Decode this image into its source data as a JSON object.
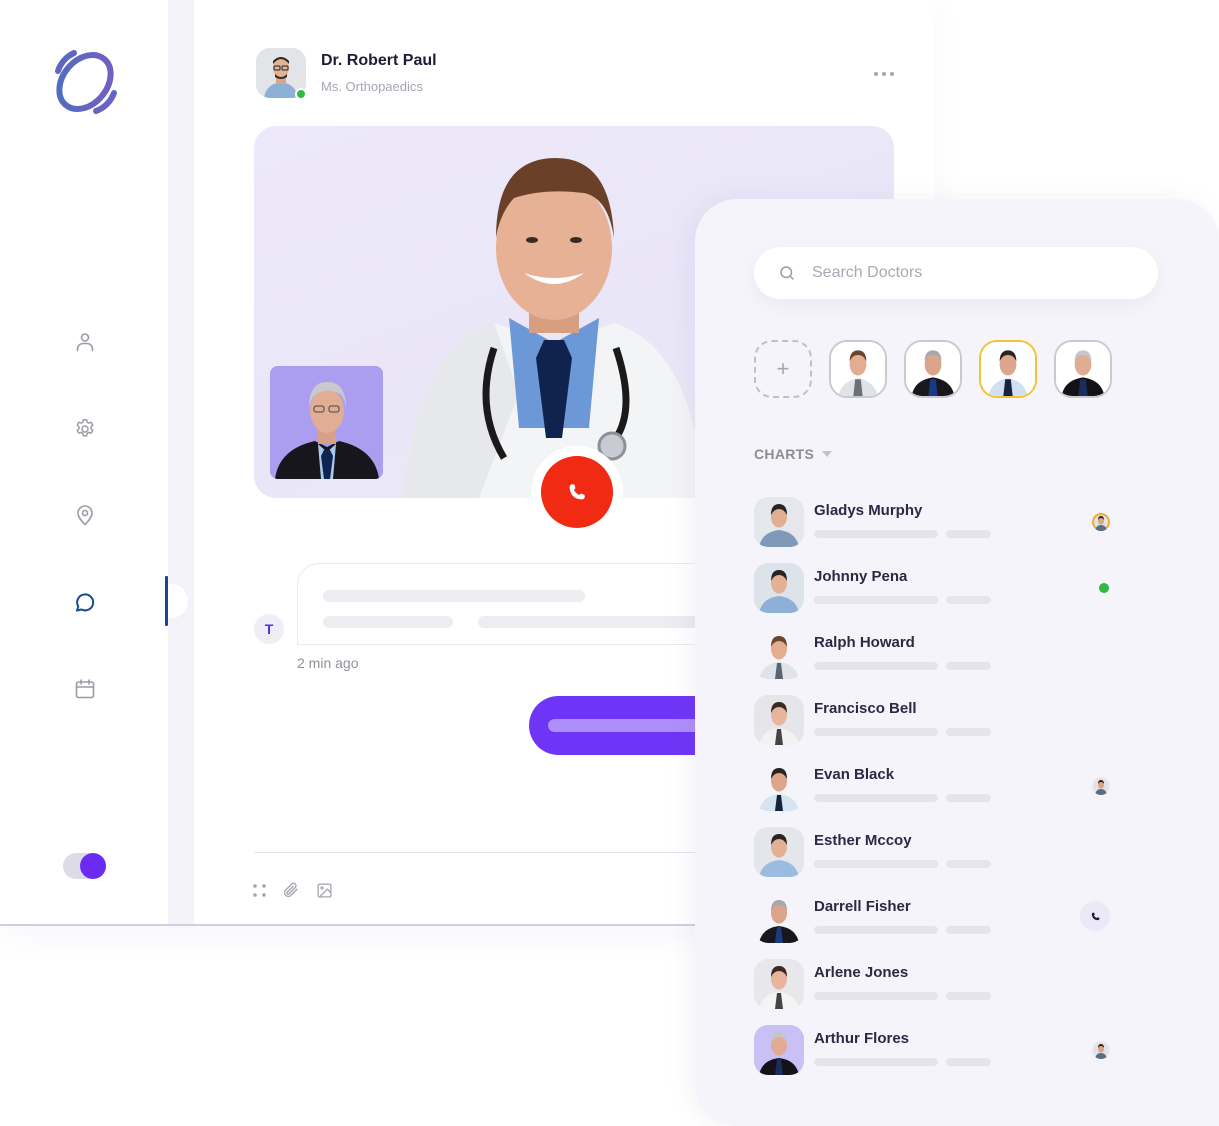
{
  "app": {
    "logo": "app-logo"
  },
  "sidebar": {
    "items": [
      {
        "id": "profile",
        "icon": "user-icon",
        "active": false
      },
      {
        "id": "settings",
        "icon": "gear-icon",
        "active": false
      },
      {
        "id": "location",
        "icon": "map-pin-icon",
        "active": false
      },
      {
        "id": "messages",
        "icon": "chat-bubble-icon",
        "active": true
      },
      {
        "id": "calendar",
        "icon": "calendar-icon",
        "active": false
      }
    ],
    "theme_toggle": {
      "state": "on"
    }
  },
  "call": {
    "doctor_name": "Dr. Robert Paul",
    "doctor_specialty": "Ms. Orthopaedics",
    "doctor_status": "online",
    "more_icon": "more-horizontal-icon",
    "end_call_icon": "phone-icon"
  },
  "chat": {
    "received": {
      "sender_initial": "T",
      "time": "2 min ago"
    },
    "composer": {
      "icons": [
        "grid-dots-icon",
        "paperclip-icon",
        "image-icon"
      ]
    }
  },
  "doctors_panel": {
    "search_placeholder": "Search Doctors",
    "search_value": "",
    "add_label": "+",
    "favorites": [
      {
        "selected": false
      },
      {
        "selected": false
      },
      {
        "selected": true
      },
      {
        "selected": false
      }
    ],
    "section_label": "CHARTS",
    "contacts": [
      {
        "name": "Gladys Murphy",
        "status": "mini-avatar"
      },
      {
        "name": "Johnny Pena",
        "status": "online-dot"
      },
      {
        "name": "Ralph Howard",
        "status": "none"
      },
      {
        "name": "Francisco Bell",
        "status": "none"
      },
      {
        "name": "Evan Black",
        "status": "mini-avatar"
      },
      {
        "name": "Esther Mccoy",
        "status": "none"
      },
      {
        "name": "Darrell Fisher",
        "status": "call-button"
      },
      {
        "name": "Arlene Jones",
        "status": "none"
      },
      {
        "name": "Arthur Flores",
        "status": "mini-avatar"
      }
    ]
  },
  "colors": {
    "accent_purple": "#6f35f6",
    "end_call_red": "#f02a13",
    "online_green": "#2dbd46",
    "selected_border": "#f2c334",
    "nav_active": "#16498f"
  }
}
